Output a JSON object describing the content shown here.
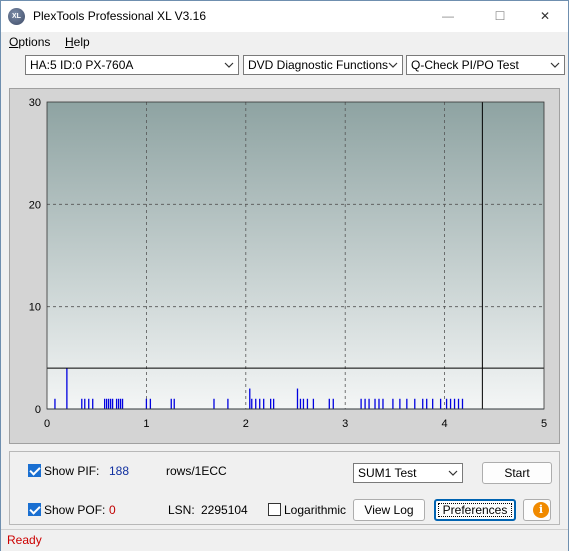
{
  "window": {
    "title": "PlexTools Professional XL V3.16",
    "icon_text": "XL"
  },
  "window_controls": {
    "minimize": "—",
    "maximize": "☐",
    "close": "✕"
  },
  "menu": [
    {
      "label": "Options",
      "underline": "O",
      "rest": "ptions"
    },
    {
      "label": "Help",
      "underline": "H",
      "rest": "elp"
    }
  ],
  "toolbar": {
    "drive": "HA:5 ID:0  PX-760A",
    "function": "DVD Diagnostic Functions",
    "test": "Q-Check PI/PO Test"
  },
  "chart_data": {
    "type": "bar",
    "xlim": [
      0,
      5
    ],
    "ylim": [
      0,
      30
    ],
    "x_ticks": [
      "0",
      "1",
      "2",
      "3",
      "4",
      "5"
    ],
    "y_ticks": [
      "0",
      "10",
      "20",
      "30"
    ],
    "grid": true,
    "threshold_y": 4,
    "end_marker_x": 4.38,
    "x": [
      0.08,
      0.2,
      0.35,
      0.38,
      0.42,
      0.46,
      0.58,
      0.6,
      0.62,
      0.64,
      0.66,
      0.7,
      0.72,
      0.74,
      0.76,
      1.0,
      1.04,
      1.25,
      1.28,
      1.68,
      1.82,
      2.04,
      2.06,
      2.1,
      2.14,
      2.18,
      2.25,
      2.28,
      2.52,
      2.55,
      2.58,
      2.62,
      2.68,
      2.84,
      2.88,
      3.16,
      3.2,
      3.24,
      3.3,
      3.34,
      3.38,
      3.48,
      3.55,
      3.62,
      3.7,
      3.78,
      3.82,
      3.88,
      3.96,
      4.02,
      4.06,
      4.1,
      4.14,
      4.18
    ],
    "values": [
      1,
      4,
      1,
      1,
      1,
      1,
      1,
      1,
      1,
      1,
      1,
      1,
      1,
      1,
      1,
      1,
      1,
      1,
      1,
      1,
      1,
      2,
      1,
      1,
      1,
      1,
      1,
      1,
      2,
      1,
      1,
      1,
      1,
      1,
      1,
      1,
      1,
      1,
      1,
      1,
      1,
      1,
      1,
      1,
      1,
      1,
      1,
      1,
      1,
      1,
      1,
      1,
      1,
      1
    ],
    "colors": {
      "bars": "#0000e0",
      "plot_bg_top": "#8ea3a2",
      "plot_bg_bottom": "#f4f6f6",
      "grid": "#555555"
    }
  },
  "controls": {
    "show_pif_label": "Show PIF:",
    "pif_value": "188",
    "pif_unit": "rows/1ECC",
    "show_pof_label": "Show POF:",
    "pof_value": "0",
    "lsn_label": "LSN:",
    "lsn_value": "2295104",
    "logarithmic_label": "Logarithmic",
    "sum_select": "SUM1 Test",
    "start_button": "Start",
    "view_log_button": "View Log",
    "preferences_button": "Preferences",
    "info_icon_glyph": "i"
  },
  "status": {
    "text": "Ready"
  }
}
